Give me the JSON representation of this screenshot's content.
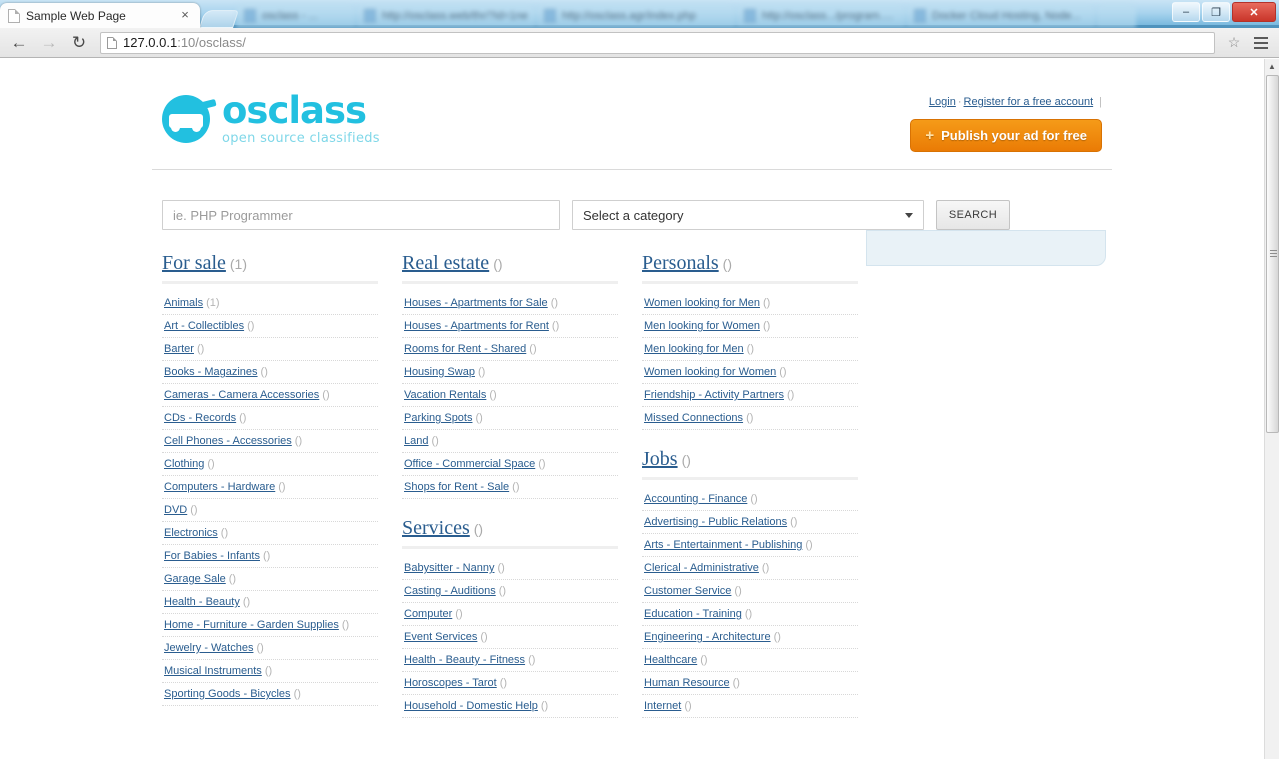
{
  "browser": {
    "active_tab": {
      "title": "Sample Web Page",
      "close_label": "×"
    },
    "background_tabs": [
      {
        "title": "osclass - ..."
      },
      {
        "title": "http://osclass.web/thr/?id=1ne"
      },
      {
        "title": "http://osclass.agr/index.php"
      },
      {
        "title": "http://osclass.../program.php"
      },
      {
        "title": "Docker Cloud Hosting, Node..."
      }
    ],
    "toolbar": {
      "back_label": "←",
      "forward_label": "→",
      "reload_label": "↻",
      "url_host": "127.0.0.1",
      "url_rest": ":10/osclass/",
      "star_label": "☆"
    },
    "window_controls": {
      "minimize": "–",
      "maximize": "❐",
      "close": "✕"
    }
  },
  "site": {
    "logo_word": "osclass",
    "logo_tagline": "open source classifieds",
    "login_label": "Login",
    "separator": "·",
    "register_label": "Register for a free account",
    "publish_label": "Publish your ad for free",
    "publish_plus": "+"
  },
  "search": {
    "placeholder": "ie. PHP Programmer",
    "value": "",
    "category_selected": "Select a category",
    "button_label": "SEARCH"
  },
  "categories": [
    {
      "column": 1,
      "groups": [
        {
          "title": "For sale",
          "count": "(1)",
          "items": [
            {
              "label": "Animals",
              "count": "(1)"
            },
            {
              "label": "Art - Collectibles",
              "count": "()"
            },
            {
              "label": "Barter",
              "count": "()"
            },
            {
              "label": "Books - Magazines",
              "count": "()"
            },
            {
              "label": "Cameras - Camera Accessories",
              "count": "()"
            },
            {
              "label": "CDs - Records",
              "count": "()"
            },
            {
              "label": "Cell Phones - Accessories",
              "count": "()"
            },
            {
              "label": "Clothing",
              "count": "()"
            },
            {
              "label": "Computers - Hardware",
              "count": "()"
            },
            {
              "label": "DVD",
              "count": "()"
            },
            {
              "label": "Electronics",
              "count": "()"
            },
            {
              "label": "For Babies - Infants",
              "count": "()"
            },
            {
              "label": "Garage Sale",
              "count": "()"
            },
            {
              "label": "Health - Beauty",
              "count": "()"
            },
            {
              "label": "Home - Furniture - Garden Supplies",
              "count": "()"
            },
            {
              "label": "Jewelry - Watches",
              "count": "()"
            },
            {
              "label": "Musical Instruments",
              "count": "()"
            },
            {
              "label": "Sporting Goods - Bicycles",
              "count": "()"
            }
          ]
        }
      ]
    },
    {
      "column": 2,
      "groups": [
        {
          "title": "Real estate",
          "count": "()",
          "items": [
            {
              "label": "Houses - Apartments for Sale",
              "count": "()"
            },
            {
              "label": "Houses - Apartments for Rent",
              "count": "()"
            },
            {
              "label": "Rooms for Rent - Shared",
              "count": "()"
            },
            {
              "label": "Housing Swap",
              "count": "()"
            },
            {
              "label": "Vacation Rentals",
              "count": "()"
            },
            {
              "label": "Parking Spots",
              "count": "()"
            },
            {
              "label": "Land",
              "count": "()"
            },
            {
              "label": "Office - Commercial Space",
              "count": "()"
            },
            {
              "label": "Shops for Rent - Sale",
              "count": "()"
            }
          ]
        },
        {
          "title": "Services",
          "count": "()",
          "items": [
            {
              "label": "Babysitter - Nanny",
              "count": "()"
            },
            {
              "label": "Casting - Auditions",
              "count": "()"
            },
            {
              "label": "Computer",
              "count": "()"
            },
            {
              "label": "Event Services",
              "count": "()"
            },
            {
              "label": "Health - Beauty - Fitness",
              "count": "()"
            },
            {
              "label": "Horoscopes - Tarot",
              "count": "()"
            },
            {
              "label": "Household - Domestic Help",
              "count": "()"
            }
          ]
        }
      ]
    },
    {
      "column": 3,
      "groups": [
        {
          "title": "Personals",
          "count": "()",
          "items": [
            {
              "label": "Women looking for Men",
              "count": "()"
            },
            {
              "label": "Men looking for Women",
              "count": "()"
            },
            {
              "label": "Men looking for Men",
              "count": "()"
            },
            {
              "label": "Women looking for Women",
              "count": "()"
            },
            {
              "label": "Friendship - Activity Partners",
              "count": "()"
            },
            {
              "label": "Missed Connections",
              "count": "()"
            }
          ]
        },
        {
          "title": "Jobs",
          "count": "()",
          "items": [
            {
              "label": "Accounting - Finance",
              "count": "()"
            },
            {
              "label": "Advertising - Public Relations",
              "count": "()"
            },
            {
              "label": "Arts - Entertainment - Publishing",
              "count": "()"
            },
            {
              "label": "Clerical - Administrative",
              "count": "()"
            },
            {
              "label": "Customer Service",
              "count": "()"
            },
            {
              "label": "Education - Training",
              "count": "()"
            },
            {
              "label": "Engineering - Architecture",
              "count": "()"
            },
            {
              "label": "Healthcare",
              "count": "()"
            },
            {
              "label": "Human Resource",
              "count": "()"
            },
            {
              "label": "Internet",
              "count": "()"
            }
          ]
        }
      ]
    }
  ],
  "colors": {
    "brand": "#22c0e0",
    "link": "#2a5d8f",
    "publish_button": "#ea7b05",
    "promo_panel": "#e9f2f7"
  }
}
